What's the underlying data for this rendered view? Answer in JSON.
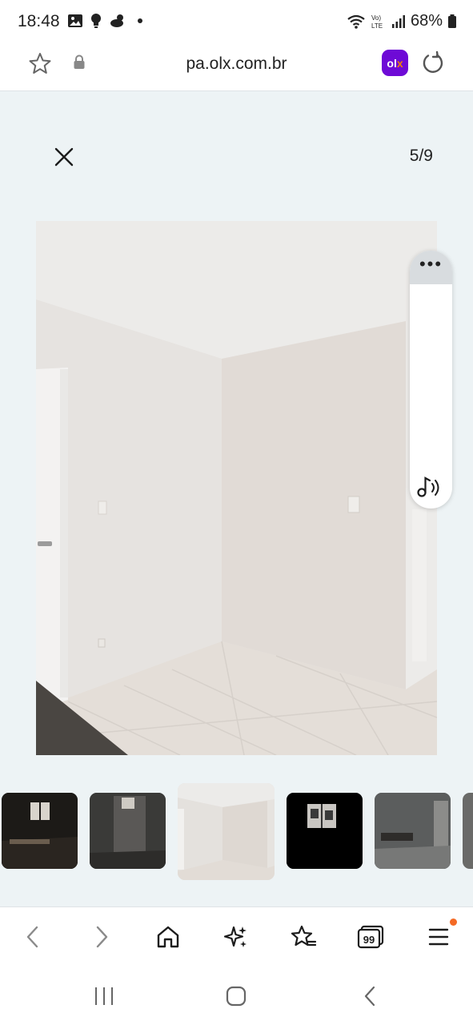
{
  "status_bar": {
    "time": "18:48",
    "battery": "68%",
    "left_icons": [
      "gallery-icon",
      "bulb-icon",
      "weather-icon",
      "dot-icon"
    ],
    "right_icons": [
      "wifi-icon",
      "volte-icon",
      "signal-icon",
      "battery-icon"
    ]
  },
  "browser": {
    "url": "pa.olx.com.br",
    "olx_badge": {
      "o": "o",
      "l": "l",
      "x": "x"
    },
    "accent": "#6e0ad6"
  },
  "viewer": {
    "counter": "5/9",
    "panel_dots": "•••",
    "thumbnails_count_visible": 6,
    "selected_thumbnail": 3
  },
  "bottom_nav": {
    "items": [
      "back-icon",
      "forward-icon",
      "home-icon",
      "sparkle-icon",
      "bookmark-star-icon",
      "tabs-icon",
      "menu-icon"
    ],
    "tabs_count": "99",
    "notification_color": "#f46a25"
  },
  "system_nav": {
    "items": [
      "recents-icon",
      "home-circle-icon",
      "system-back-icon"
    ]
  }
}
